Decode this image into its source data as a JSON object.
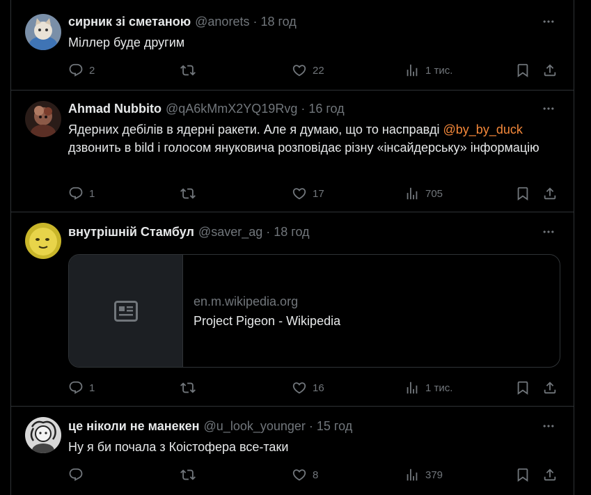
{
  "tweets": [
    {
      "name": "сирник зі сметаною",
      "handle": "@anorets",
      "sep": "·",
      "time": "18 год",
      "text": "Міллер буде другим",
      "replies": "2",
      "likes": "22",
      "views": "1 тис."
    },
    {
      "name": "Ahmad Nubbito",
      "handle": "@qA6kMmX2YQ19Rvg",
      "sep": "·",
      "time": "16 год",
      "text_before": "Ядерних дебілів в ядерні ракети. Але я думаю, що то насправді ",
      "mention": "@by_by_duck",
      "text_after": " дзвонить в bild і голосом януковича розповідає різну «інсайдерську» інформацію",
      "replies": "1",
      "likes": "17",
      "views": "705"
    },
    {
      "name": "внутрішній Стамбул",
      "handle": "@saver_ag",
      "sep": "·",
      "time": "18 год",
      "card": {
        "domain": "en.m.wikipedia.org",
        "title": "Project Pigeon - Wikipedia",
        "icon": "article-icon"
      },
      "replies": "1",
      "likes": "16",
      "views": "1 тис."
    },
    {
      "name": "це ніколи не манекен",
      "handle": "@u_look_younger",
      "sep": "·",
      "time": "15 год",
      "text": "Ну я би почала з Коістофера все-таки",
      "replies": "",
      "likes": "8",
      "views": "379"
    }
  ],
  "colors": {
    "background": "#000000",
    "text": "#e7e9ea",
    "muted": "#71767b",
    "mention": "#f4883a",
    "border": "#2f3336"
  }
}
